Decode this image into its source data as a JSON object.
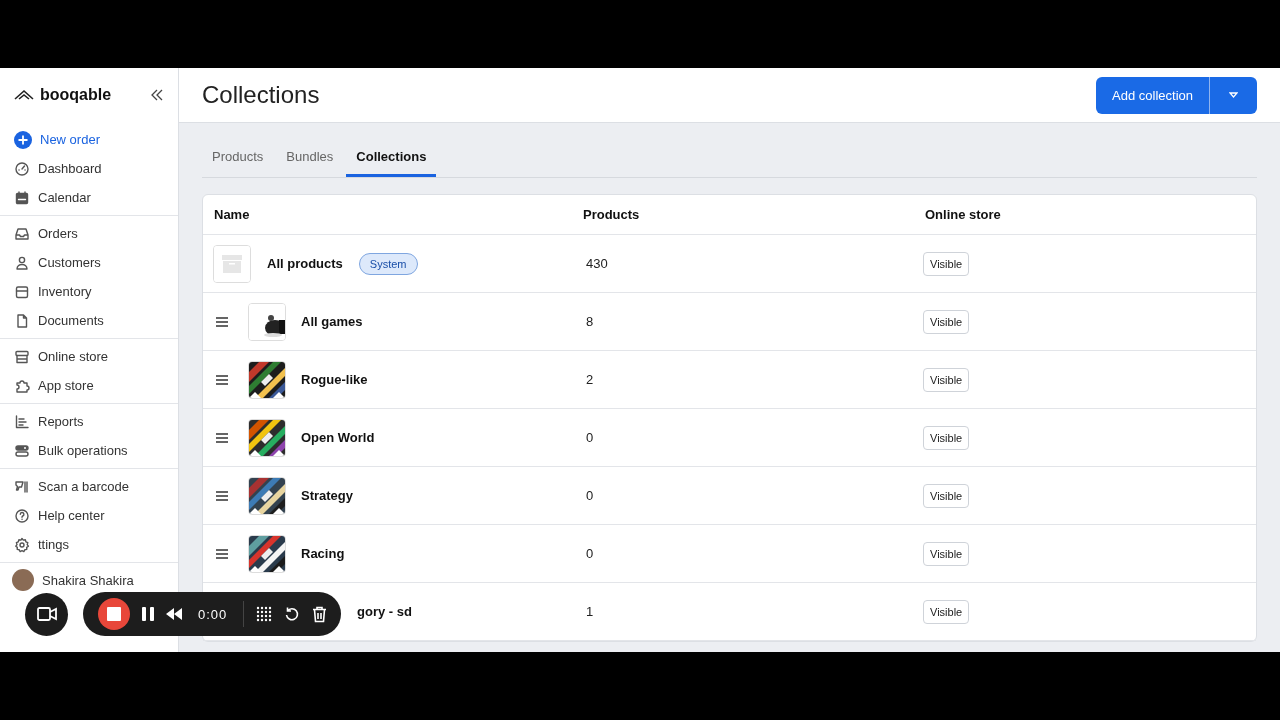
{
  "brand": {
    "name": "booqable"
  },
  "sidebar": {
    "groups": [
      [
        {
          "label": "New order",
          "kind": "action"
        },
        {
          "label": "Dashboard",
          "kind": "link"
        },
        {
          "label": "Calendar",
          "kind": "link"
        }
      ],
      [
        {
          "label": "Orders",
          "kind": "link"
        },
        {
          "label": "Customers",
          "kind": "link"
        },
        {
          "label": "Inventory",
          "kind": "link"
        },
        {
          "label": "Documents",
          "kind": "link"
        }
      ],
      [
        {
          "label": "Online store",
          "kind": "link"
        },
        {
          "label": "App store",
          "kind": "link"
        }
      ],
      [
        {
          "label": "Reports",
          "kind": "link"
        },
        {
          "label": "Bulk operations",
          "kind": "link"
        }
      ],
      [
        {
          "label": "Scan a barcode",
          "kind": "link"
        },
        {
          "label": "Help center",
          "kind": "link"
        },
        {
          "label": "ttings",
          "kind": "link"
        }
      ]
    ],
    "user": {
      "name": "Shakira Shakira"
    }
  },
  "page": {
    "title": "Collections",
    "primary_button": "Add collection"
  },
  "tabs": [
    {
      "label": "Products",
      "selected": false
    },
    {
      "label": "Bundles",
      "selected": false
    },
    {
      "label": "Collections",
      "selected": true
    }
  ],
  "table": {
    "columns": [
      "Name",
      "Products",
      "Online store"
    ],
    "rows": [
      {
        "kind": "system",
        "name": "All products",
        "badge": "System",
        "products": "430",
        "online_store": "Visible"
      },
      {
        "kind": "collection",
        "name": "All games",
        "products": "8",
        "online_store": "Visible"
      },
      {
        "kind": "collection",
        "name": "Rogue-like",
        "products": "2",
        "online_store": "Visible"
      },
      {
        "kind": "collection",
        "name": "Open World",
        "products": "0",
        "online_store": "Visible"
      },
      {
        "kind": "collection",
        "name": "Strategy",
        "products": "0",
        "online_store": "Visible"
      },
      {
        "kind": "collection",
        "name": "Racing",
        "products": "0",
        "online_store": "Visible"
      },
      {
        "kind": "covered",
        "name": "gory - sd",
        "products": "1",
        "online_store": "Visible"
      }
    ]
  },
  "recorder": {
    "time": "0:00"
  }
}
